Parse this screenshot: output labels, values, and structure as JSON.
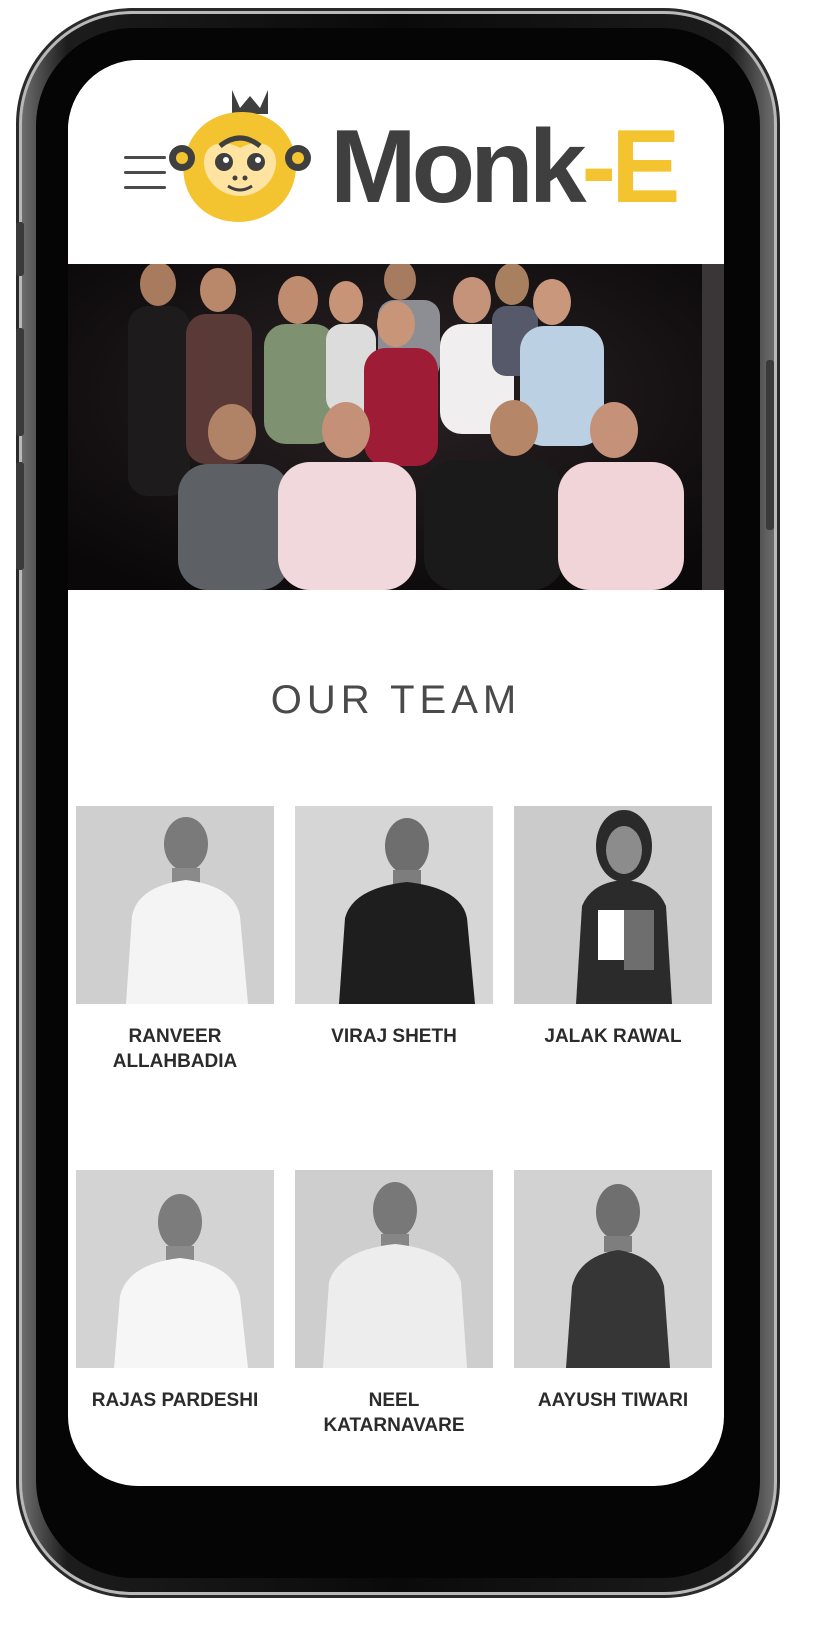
{
  "brand": {
    "logo_text_main": "Monk",
    "logo_text_accent": "-E",
    "accent_color": "#f4c430",
    "text_color": "#3f3f3f"
  },
  "menu": {
    "icon": "hamburger-menu-icon"
  },
  "hero": {
    "alt": "team-group-photo"
  },
  "section": {
    "title": "OUR TEAM"
  },
  "team": [
    {
      "name": "RANVEER ALLAHBADIA"
    },
    {
      "name": "VIRAJ SHETH"
    },
    {
      "name": "JALAK RAWAL"
    },
    {
      "name": "RAJAS PARDESHI"
    },
    {
      "name": "NEEL KATARNAVARE"
    },
    {
      "name": "AAYUSH TIWARI"
    }
  ]
}
